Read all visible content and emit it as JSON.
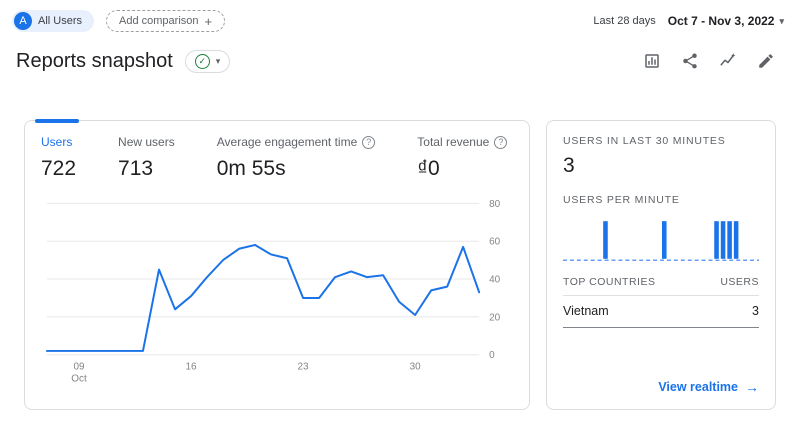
{
  "icons": {
    "caret_down": "▾",
    "plus": "+",
    "check": "✓",
    "help": "?",
    "arrow_right": "→"
  },
  "topbar": {
    "avatar_letter": "A",
    "segment_chip": "All Users",
    "add_comparison_label": "Add comparison",
    "date_range_type": "Last 28 days",
    "date_range_value": "Oct 7 - Nov 3, 2022"
  },
  "header": {
    "title": "Reports snapshot"
  },
  "metrics": [
    {
      "label": "Users",
      "value": "722"
    },
    {
      "label": "New users",
      "value": "713"
    },
    {
      "label": "Average engagement time",
      "value": "0m 55s"
    },
    {
      "label": "Total revenue",
      "value": "₫0"
    }
  ],
  "chart_data": [
    {
      "type": "line",
      "title": "Users",
      "x": [
        "Oct 7",
        "Oct 8",
        "Oct 9",
        "Oct 10",
        "Oct 11",
        "Oct 12",
        "Oct 13",
        "Oct 14",
        "Oct 15",
        "Oct 16",
        "Oct 17",
        "Oct 18",
        "Oct 19",
        "Oct 20",
        "Oct 21",
        "Oct 22",
        "Oct 23",
        "Oct 24",
        "Oct 25",
        "Oct 26",
        "Oct 27",
        "Oct 28",
        "Oct 29",
        "Oct 30",
        "Oct 31",
        "Nov 1",
        "Nov 2",
        "Nov 3"
      ],
      "values": [
        2,
        2,
        2,
        2,
        2,
        2,
        2,
        45,
        24,
        31,
        41,
        50,
        56,
        58,
        53,
        51,
        30,
        30,
        41,
        44,
        41,
        42,
        28,
        21,
        34,
        36,
        57,
        33
      ],
      "x_ticks": [
        {
          "label": "09",
          "sublabel": "Oct",
          "index": 2
        },
        {
          "label": "16",
          "index": 9
        },
        {
          "label": "23",
          "index": 16
        },
        {
          "label": "30",
          "index": 23
        }
      ],
      "y_ticks": [
        0,
        20,
        40,
        60,
        80
      ],
      "ylim": [
        0,
        80
      ],
      "grid": true,
      "y_axis_position": "right",
      "color": "#1a73e8"
    },
    {
      "type": "bar",
      "title": "Users per minute",
      "values": [
        0,
        0,
        0,
        0,
        0,
        0,
        1,
        0,
        0,
        0,
        0,
        0,
        0,
        0,
        0,
        1,
        0,
        0,
        0,
        0,
        0,
        0,
        0,
        1,
        1,
        1,
        1,
        0,
        0,
        0
      ],
      "ylim": [
        0,
        1
      ],
      "color": "#1a73e8",
      "baseline_color": "#669df6"
    }
  ],
  "realtime": {
    "last30_label": "USERS IN LAST 30 MINUTES",
    "last30_value": "3",
    "per_minute_label": "USERS PER MINUTE",
    "countries_header": "TOP COUNTRIES",
    "users_header": "USERS",
    "rows": [
      {
        "country": "Vietnam",
        "users": "3"
      }
    ],
    "view_realtime_label": "View realtime"
  }
}
